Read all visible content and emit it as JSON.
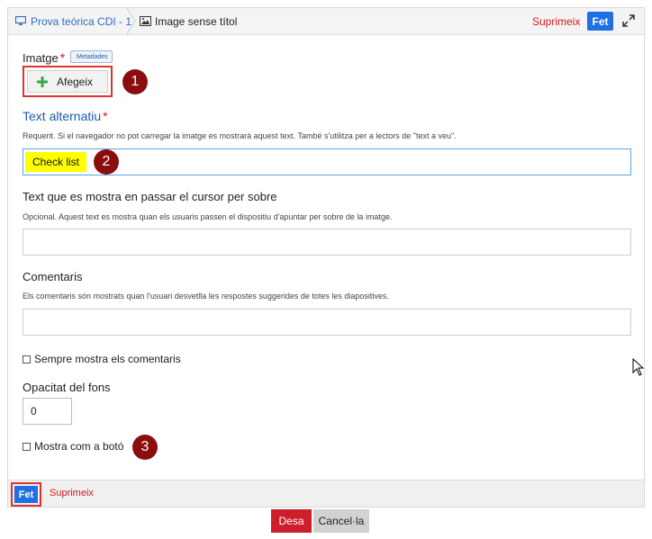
{
  "topbar": {
    "breadcrumb_parent": "Prova teòrica CDI - 1",
    "breadcrumb_current": "Image sense títol",
    "delete_label": "Suprimeix",
    "done_label": "Fet"
  },
  "form": {
    "image_label": "Imatge",
    "required_mark": "*",
    "metadata_tag": "Metadades",
    "add_button_label": "Afegeix",
    "alt_text_label": "Text alternatiu",
    "alt_text_help": "Requerit. Si el navegador no pot carregar la imatge es mostrarà aquest text. També s'utilitza per a lectors de \"text a veu\".",
    "alt_text_value": "Check list",
    "hover_text_label": "Text que es mostra en passar el cursor per sobre",
    "hover_text_help": "Opcional. Aquest text es mostra quan els usuaris passen el dispositiu d'apuntar per sobre de la imatge.",
    "comments_label": "Comentaris",
    "comments_help": "Els comentaris són mostrats quan l'usuari desvetlla les respostes suggerides de totes les diapositives.",
    "always_show_comments_label": "Sempre mostra els comentaris",
    "background_opacity_label": "Opacitat del fons",
    "background_opacity_value": "0",
    "show_as_button_label": "Mostra com a botó"
  },
  "markers": [
    "1",
    "2",
    "3"
  ],
  "bottombar": {
    "done_label": "Fet",
    "delete_label": "Suprimeix"
  },
  "footer": {
    "save_label": "Desa",
    "cancel_label": "Cancel·la"
  },
  "colors": {
    "accent_blue": "#1f6fe5",
    "delete_red": "#d11a1a",
    "marker": "#8b0d0d",
    "highlight": "#ffff00"
  }
}
